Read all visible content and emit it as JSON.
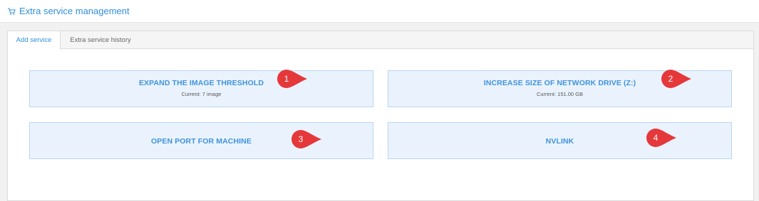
{
  "header": {
    "title": "Extra service management",
    "icon": "cart-icon",
    "accent_color": "#2f8fde"
  },
  "tabs": [
    {
      "label": "Add service",
      "active": true
    },
    {
      "label": "Extra service history",
      "active": false
    }
  ],
  "cards": [
    {
      "title": "EXPAND THE IMAGE THRESHOLD",
      "subtitle": "Current: 7 image",
      "marker": "1"
    },
    {
      "title": "INCREASE SIZE OF NETWORK DRIVE (Z:)",
      "subtitle": "Current: 151.00 GB",
      "marker": "2"
    },
    {
      "title": "OPEN PORT FOR MACHINE",
      "marker": "3"
    },
    {
      "title": "NVLINK",
      "marker": "4"
    }
  ],
  "marker_color": "#e5383b",
  "card_color": "#eaf3fd"
}
